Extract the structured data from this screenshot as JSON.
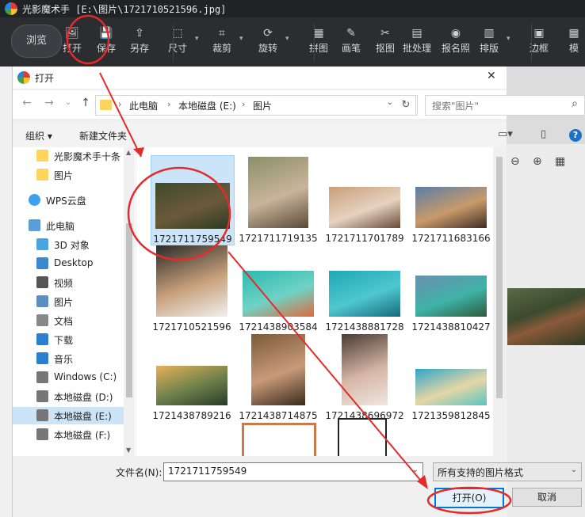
{
  "app": {
    "title": "光影魔术手 [E:\\图片\\1721710521596.jpg]",
    "browse_label": "浏览",
    "tools": [
      {
        "label": "打开",
        "icon": "open-image-icon"
      },
      {
        "label": "保存",
        "icon": "save-icon"
      },
      {
        "label": "另存",
        "icon": "save-as-icon"
      },
      {
        "label": "尺寸",
        "icon": "resize-icon"
      },
      {
        "label": "裁剪",
        "icon": "crop-icon"
      },
      {
        "label": "旋转",
        "icon": "rotate-icon"
      },
      {
        "label": "拼图",
        "icon": "collage-icon"
      },
      {
        "label": "画笔",
        "icon": "brush-icon"
      },
      {
        "label": "抠图",
        "icon": "cutout-icon"
      },
      {
        "label": "批处理",
        "icon": "batch-icon"
      },
      {
        "label": "报名照",
        "icon": "id-photo-icon"
      },
      {
        "label": "排版",
        "icon": "layout-icon"
      },
      {
        "label": "边框",
        "icon": "frame-icon"
      },
      {
        "label": "模",
        "icon": "template-icon"
      }
    ]
  },
  "dialog": {
    "title": "打开",
    "close_glyph": "✕",
    "breadcrumb": [
      "此电脑",
      "本地磁盘 (E:)",
      "图片"
    ],
    "search_placeholder": "搜索\"图片\"",
    "organize_label": "组织 ▾",
    "new_folder_label": "新建文件夹",
    "nav_items": [
      {
        "label": "光影魔术手十条",
        "icon": "folder-icon",
        "selected": false
      },
      {
        "label": "图片",
        "icon": "folder-icon",
        "selected": false
      },
      {
        "label": "WPS云盘",
        "icon": "cloud-icon",
        "selected": false
      },
      {
        "label": "此电脑",
        "icon": "computer-icon",
        "selected": false
      },
      {
        "label": "3D 对象",
        "icon": "cube-icon",
        "selected": false
      },
      {
        "label": "Desktop",
        "icon": "desktop-icon",
        "selected": false
      },
      {
        "label": "视频",
        "icon": "video-icon",
        "selected": false
      },
      {
        "label": "图片",
        "icon": "pictures-icon",
        "selected": false
      },
      {
        "label": "文档",
        "icon": "document-icon",
        "selected": false
      },
      {
        "label": "下载",
        "icon": "download-icon",
        "selected": false
      },
      {
        "label": "音乐",
        "icon": "music-icon",
        "selected": false
      },
      {
        "label": "Windows (C:)",
        "icon": "drive-icon",
        "selected": false
      },
      {
        "label": "本地磁盘 (D:)",
        "icon": "drive-icon",
        "selected": false
      },
      {
        "label": "本地磁盘 (E:)",
        "icon": "drive-icon",
        "selected": true
      },
      {
        "label": "本地磁盘 (F:)",
        "icon": "drive-icon",
        "selected": false
      }
    ],
    "files": [
      {
        "name": "1721711759549",
        "selected": true,
        "colors": [
          "#3e4a2c",
          "#6b5a3a",
          "#2c3a22"
        ]
      },
      {
        "name": "1721711719135",
        "selected": false,
        "colors": [
          "#8a8f6a",
          "#c9b49a",
          "#5a4a3a"
        ]
      },
      {
        "name": "1721711701789",
        "selected": false,
        "colors": [
          "#c89e7a",
          "#e6d2c0",
          "#6a4a3a"
        ]
      },
      {
        "name": "1721711683166",
        "selected": false,
        "colors": [
          "#5a7fa6",
          "#c99a6a",
          "#3e2e24"
        ]
      },
      {
        "name": "1721710521596",
        "selected": false,
        "colors": [
          "#2a2a2a",
          "#c7a07a",
          "#f0f0f0"
        ]
      },
      {
        "name": "1721438903584",
        "selected": false,
        "colors": [
          "#2fb8b0",
          "#6ed3c6",
          "#e06a3a"
        ]
      },
      {
        "name": "1721438881728",
        "selected": false,
        "colors": [
          "#1fa7b6",
          "#4fc7cf",
          "#156a7a"
        ]
      },
      {
        "name": "1721438810427",
        "selected": false,
        "colors": [
          "#6a8fb0",
          "#3fb3a8",
          "#2e5a3a"
        ]
      },
      {
        "name": "1721438789216",
        "selected": false,
        "colors": [
          "#e6b15a",
          "#6a7f4a",
          "#2a3a2a"
        ]
      },
      {
        "name": "1721438714875",
        "selected": false,
        "colors": [
          "#7a5a3a",
          "#c99a7a",
          "#3a2a1a"
        ]
      },
      {
        "name": "1721438696972",
        "selected": false,
        "colors": [
          "#4a3a34",
          "#d6b6a6",
          "#eee6e0"
        ]
      },
      {
        "name": "1721359812845",
        "selected": false,
        "colors": [
          "#2fa5c9",
          "#e6d6a6",
          "#56c5c0"
        ]
      }
    ],
    "filename_label": "文件名(N):",
    "filename_value": "1721711759549",
    "filetype_value": "所有支持的图片格式",
    "open_label": "打开(O)",
    "cancel_label": "取消"
  },
  "colors": {
    "annotation_red": "#e32b2b",
    "selection_bg": "#cce4f7",
    "accent_blue": "#0078d7"
  }
}
